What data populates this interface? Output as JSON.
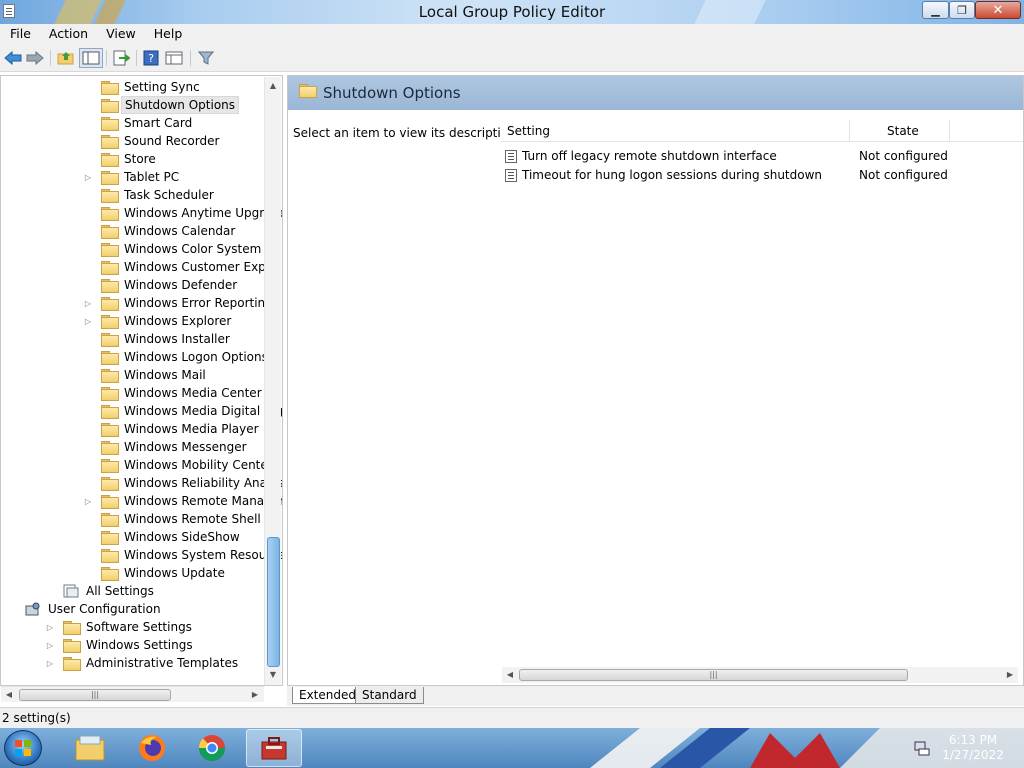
{
  "window": {
    "title": "Local Group Policy Editor"
  },
  "menubar": [
    "File",
    "Action",
    "View",
    "Help"
  ],
  "tree": {
    "items": [
      {
        "label": "Setting Sync",
        "indent": 2,
        "expander": false,
        "selected": false
      },
      {
        "label": "Shutdown Options",
        "indent": 2,
        "expander": false,
        "selected": true
      },
      {
        "label": "Smart Card",
        "indent": 2,
        "expander": false,
        "selected": false
      },
      {
        "label": "Sound Recorder",
        "indent": 2,
        "expander": false,
        "selected": false
      },
      {
        "label": "Store",
        "indent": 2,
        "expander": false,
        "selected": false
      },
      {
        "label": "Tablet PC",
        "indent": 2,
        "expander": true,
        "selected": false
      },
      {
        "label": "Task Scheduler",
        "indent": 2,
        "expander": false,
        "selected": false
      },
      {
        "label": "Windows Anytime Upgrade",
        "indent": 2,
        "expander": false,
        "selected": false
      },
      {
        "label": "Windows Calendar",
        "indent": 2,
        "expander": false,
        "selected": false
      },
      {
        "label": "Windows Color System",
        "indent": 2,
        "expander": false,
        "selected": false
      },
      {
        "label": "Windows Customer Experience",
        "indent": 2,
        "expander": false,
        "selected": false
      },
      {
        "label": "Windows Defender",
        "indent": 2,
        "expander": false,
        "selected": false
      },
      {
        "label": "Windows Error Reporting",
        "indent": 2,
        "expander": true,
        "selected": false
      },
      {
        "label": "Windows Explorer",
        "indent": 2,
        "expander": true,
        "selected": false
      },
      {
        "label": "Windows Installer",
        "indent": 2,
        "expander": false,
        "selected": false
      },
      {
        "label": "Windows Logon Options",
        "indent": 2,
        "expander": false,
        "selected": false
      },
      {
        "label": "Windows Mail",
        "indent": 2,
        "expander": false,
        "selected": false
      },
      {
        "label": "Windows Media Center",
        "indent": 2,
        "expander": false,
        "selected": false
      },
      {
        "label": "Windows Media Digital Rights",
        "indent": 2,
        "expander": false,
        "selected": false
      },
      {
        "label": "Windows Media Player",
        "indent": 2,
        "expander": false,
        "selected": false
      },
      {
        "label": "Windows Messenger",
        "indent": 2,
        "expander": false,
        "selected": false
      },
      {
        "label": "Windows Mobility Center",
        "indent": 2,
        "expander": false,
        "selected": false
      },
      {
        "label": "Windows Reliability Analysis",
        "indent": 2,
        "expander": false,
        "selected": false
      },
      {
        "label": "Windows Remote Managemen",
        "indent": 2,
        "expander": true,
        "selected": false
      },
      {
        "label": "Windows Remote Shell",
        "indent": 2,
        "expander": false,
        "selected": false
      },
      {
        "label": "Windows SideShow",
        "indent": 2,
        "expander": false,
        "selected": false
      },
      {
        "label": "Windows System Resource Ma",
        "indent": 2,
        "expander": false,
        "selected": false
      },
      {
        "label": "Windows Update",
        "indent": 2,
        "expander": false,
        "selected": false
      },
      {
        "label": "All Settings",
        "indent": 1,
        "expander": false,
        "selected": false,
        "icon": "settings-list-icon"
      },
      {
        "label": "User Configuration",
        "indent": 0,
        "expander": "open",
        "selected": false,
        "icon": "user-config-icon"
      },
      {
        "label": "Software Settings",
        "indent": 1,
        "expander": true,
        "selected": false
      },
      {
        "label": "Windows Settings",
        "indent": 1,
        "expander": true,
        "selected": false
      },
      {
        "label": "Administrative Templates",
        "indent": 1,
        "expander": true,
        "selected": false
      }
    ]
  },
  "right": {
    "header_title": "Shutdown Options",
    "description": "Select an item to view its description.",
    "columns": {
      "setting": "Setting",
      "state": "State"
    },
    "rows": [
      {
        "setting": "Turn off legacy remote shutdown interface",
        "state": "Not configured"
      },
      {
        "setting": "Timeout for hung logon sessions during shutdown",
        "state": "Not configured"
      }
    ]
  },
  "tabs": {
    "extended": "Extended",
    "standard": "Standard"
  },
  "status": {
    "text": "2 setting(s)"
  },
  "taskbar": {
    "time": "6:13 PM",
    "date": "1/27/2022"
  },
  "colors": {
    "header_blue": "#9ab7d6",
    "close_red": "#c94b34",
    "taskbar_blue": "#4f86bd"
  }
}
